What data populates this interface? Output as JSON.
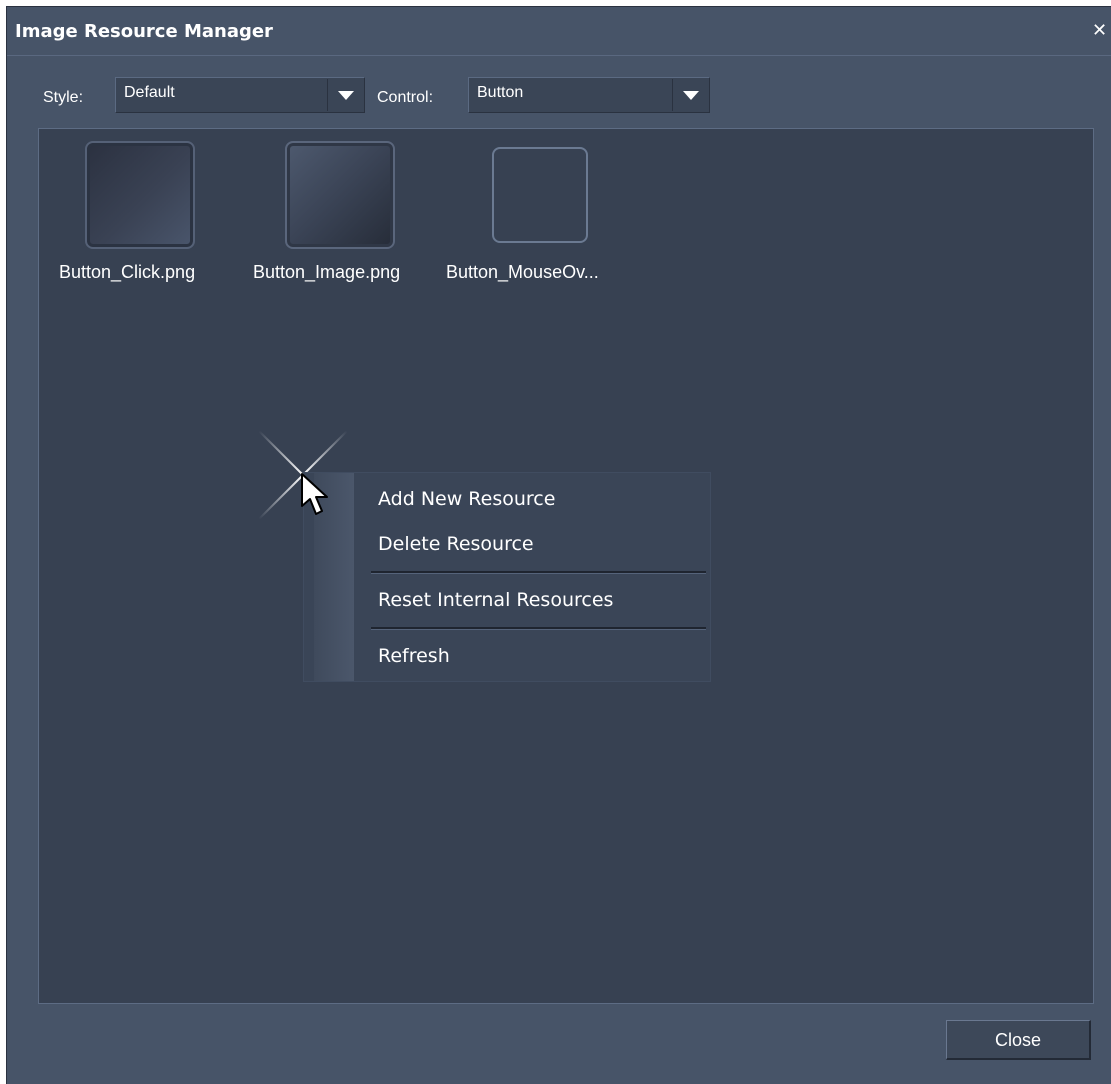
{
  "window": {
    "title": "Image Resource Manager",
    "close_glyph": "✕"
  },
  "toolbar": {
    "style_label": "Style:",
    "style_value": "Default",
    "control_label": "Control:",
    "control_value": "Button"
  },
  "resources": [
    {
      "name": "Button_Click.png"
    },
    {
      "name": "Button_Image.png"
    },
    {
      "name": "Button_MouseOv..."
    }
  ],
  "context_menu": {
    "items": [
      "Add New Resource",
      "Delete Resource",
      "Reset Internal Resources",
      "Refresh"
    ]
  },
  "footer": {
    "close_label": "Close"
  },
  "icons": [
    "close-icon",
    "dropdown-arrow-icon",
    "mouse-cursor-icon",
    "click-sparkle-icon"
  ],
  "colors": {
    "window_bg": "#475468",
    "panel_bg": "#374152",
    "text": "#ffffff"
  }
}
